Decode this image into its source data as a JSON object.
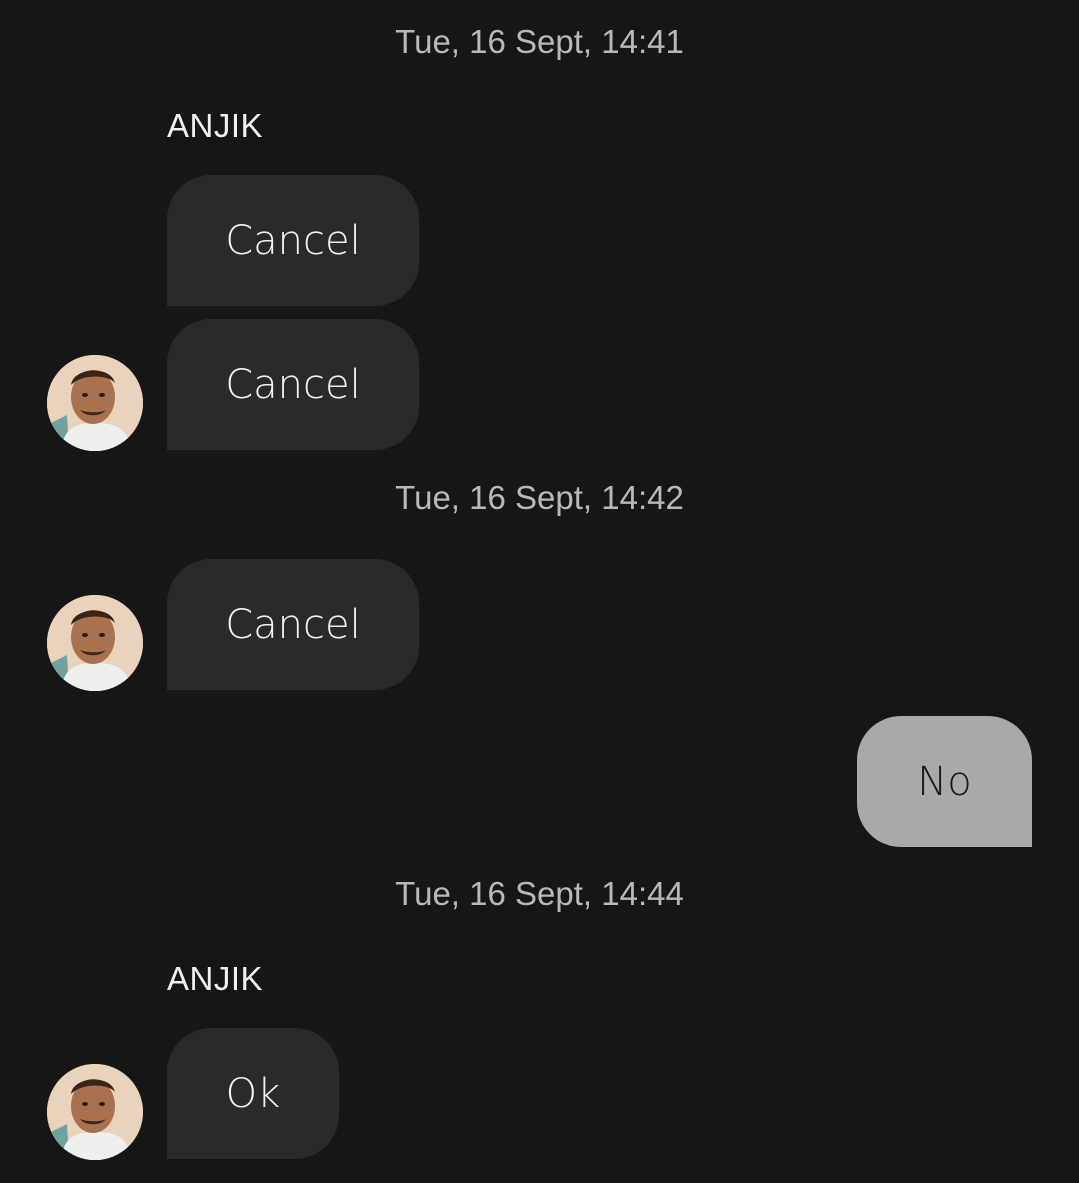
{
  "messages": [
    {
      "timestamp": "Tue, 16 Sept, 14:41"
    },
    {
      "sender": "ANJIK"
    },
    {
      "text": "Cancel"
    },
    {
      "text": "Cancel"
    },
    {
      "timestamp": "Tue, 16 Sept, 14:42"
    },
    {
      "text": "Cancel"
    },
    {
      "text": "No"
    },
    {
      "timestamp": "Tue, 16 Sept, 14:44"
    },
    {
      "sender": "ANJIK"
    },
    {
      "text": "Ok"
    }
  ],
  "colors": {
    "background": "#161616",
    "incoming_bubble": "#2a2a2a",
    "outgoing_bubble": "#a9a9a9",
    "timestamp_text": "#b9b9b9"
  },
  "icons": {
    "avatar": "contact-avatar-photo"
  }
}
